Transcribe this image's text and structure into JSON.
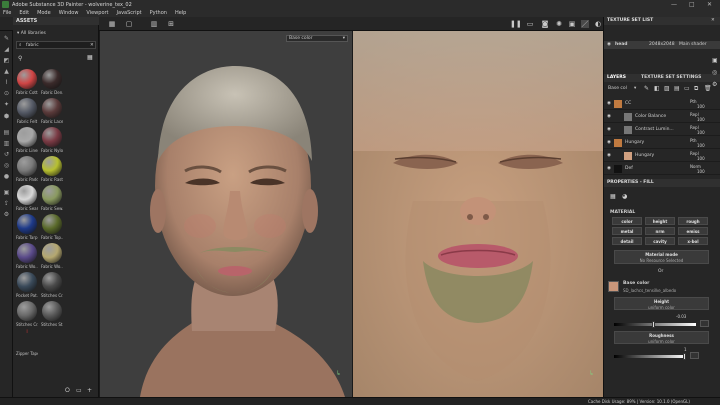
{
  "window": {
    "title": "Adobe Substance 3D Painter - wolverine_tex_02",
    "controls": [
      "—",
      "□",
      "✕"
    ]
  },
  "menu": [
    "File",
    "Edit",
    "Mode",
    "Window",
    "Viewport",
    "JavaScript",
    "Python",
    "Help"
  ],
  "assets": {
    "title": "ASSETS",
    "filter_label": "All libraries",
    "search_value": "fabric",
    "materials": [
      {
        "label": "Fabric Cott...",
        "color": "#d14545"
      },
      {
        "label": "Fabric Den...",
        "color": "#3a2a2a"
      },
      {
        "label": "Fabric Felt",
        "color": "#555a66"
      },
      {
        "label": "Fabric Lace",
        "color": "#5a3a3a"
      },
      {
        "label": "Fabric Linen",
        "color": "#a8a8a8"
      },
      {
        "label": "Fabric Nylon",
        "color": "#7a3a44"
      },
      {
        "label": "Fabric Padd...",
        "color": "#7a7a7a"
      },
      {
        "label": "Fabric Rast...",
        "color": "#b7c030"
      },
      {
        "label": "Fabric Seam",
        "color": "#d8d8d8"
      },
      {
        "label": "Fabric Sew...",
        "color": "#8a9a60"
      },
      {
        "label": "Fabric Tarp...",
        "color": "#1e3a8a"
      },
      {
        "label": "Fabric Top...",
        "color": "#5a6a2a"
      },
      {
        "label": "Fabric Wo...",
        "color": "#5a4a8a"
      },
      {
        "label": "Fabric Wo...",
        "color": "#b5a870"
      },
      {
        "label": "Pocket Pat...",
        "color": "#3a4a5a"
      },
      {
        "label": "Stitches Cr...",
        "color": "#4a4a4a"
      },
      {
        "label": "Stitches Cr...",
        "color": "#6a6a6a"
      },
      {
        "label": "Stitches St...",
        "color": "#5a5a5a"
      },
      {
        "label": "Zipper Tape",
        "color": "#2a2a2a"
      }
    ]
  },
  "viewport": {
    "channel_3d": "Base color",
    "channel_2d": "Base color"
  },
  "texture_set_list": {
    "title": "TEXTURE SET LIST",
    "item_name": "head",
    "item_res": "2048x2048",
    "item_shader": "Main shader"
  },
  "tabs": {
    "layers": "LAYERS",
    "texture_set_settings": "TEXTURE SET SETTINGS"
  },
  "layers": {
    "channel": "Base col",
    "items": [
      {
        "name": "CC",
        "blend": "Pth",
        "opacity": "100",
        "type": "folder"
      },
      {
        "name": "Color Balance",
        "blend": "Repl",
        "opacity": "100",
        "type": "filter"
      },
      {
        "name": "Contrast Lumin...",
        "blend": "Repl",
        "opacity": "100",
        "type": "filter"
      },
      {
        "name": "Hungary",
        "blend": "Pth",
        "opacity": "100",
        "type": "folder"
      },
      {
        "name": "Hungary",
        "blend": "Repl",
        "opacity": "100",
        "type": "fill"
      },
      {
        "name": "Def",
        "blend": "Norm",
        "opacity": "100",
        "type": "fill"
      }
    ]
  },
  "properties": {
    "title": "PROPERTIES - FILL",
    "material_title": "MATERIAL",
    "channels": [
      "color",
      "height",
      "rough",
      "metal",
      "nrm",
      "emiss",
      "detail",
      "cavity",
      "x-bol"
    ],
    "material_mode": "Material mode",
    "material_sub": "No Resource Selected",
    "or_label": "Or",
    "base_color_title": "Base color",
    "base_color_file": "SD_lachcs_tensilke_albedo",
    "height_title": "Height",
    "height_sub": "uniform color",
    "height_value": "-0.03",
    "roughness_title": "Roughness",
    "roughness_sub": "uniform color",
    "roughness_value": "1"
  },
  "status": {
    "left": "",
    "right": "Cache Disk Usage:   89%  |  Version: 10.1.0 (OpenGL)"
  }
}
